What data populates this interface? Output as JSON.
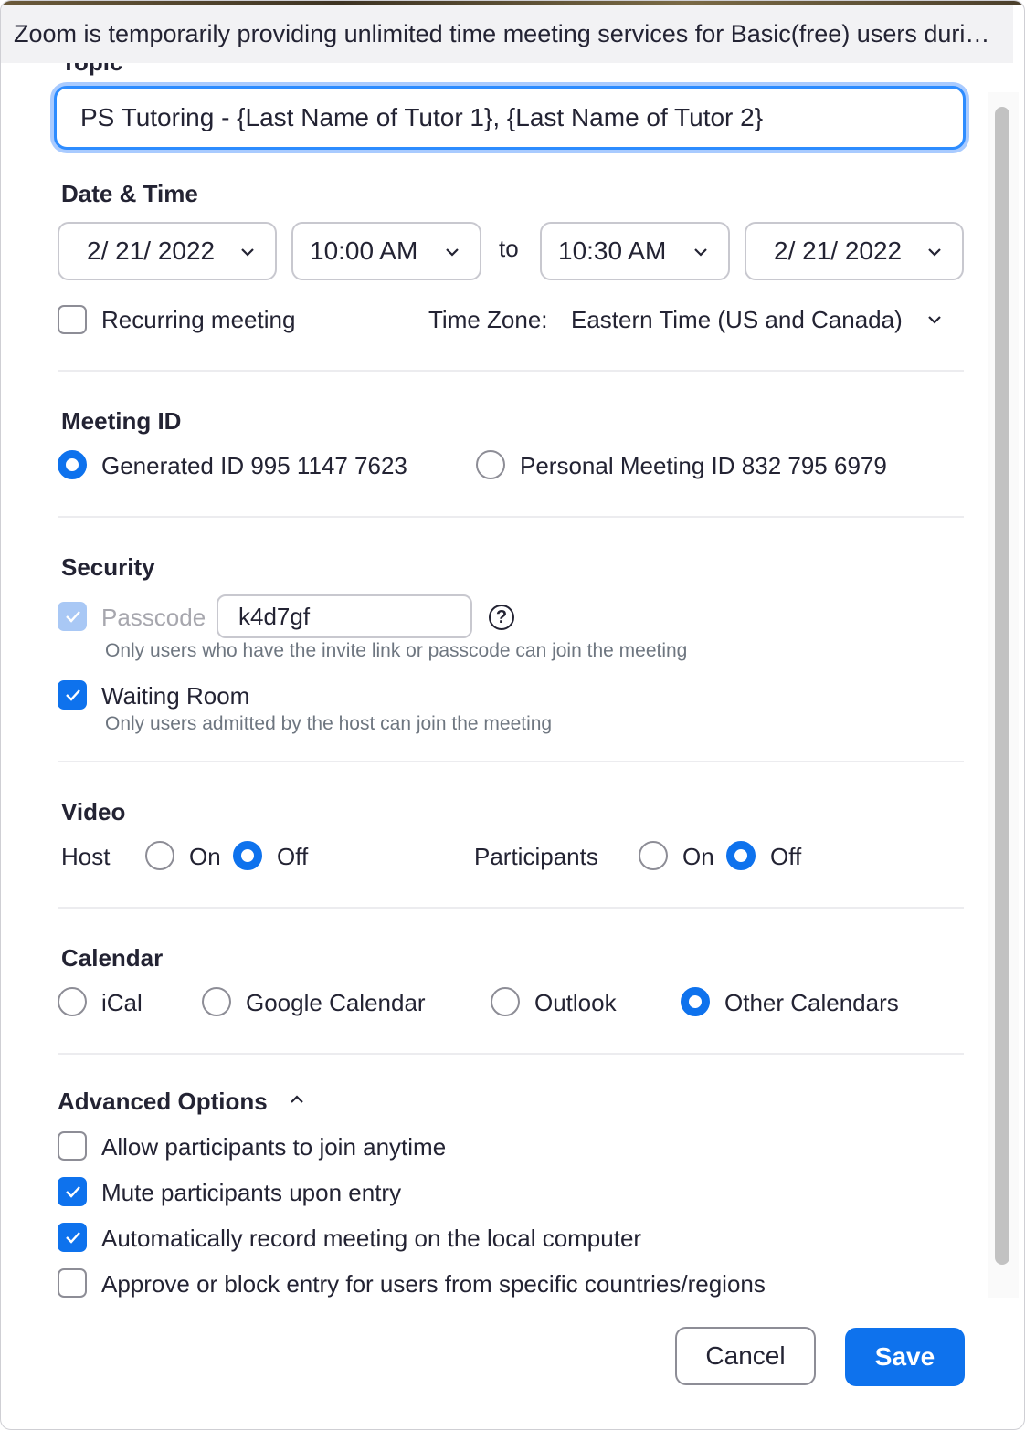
{
  "banner": {
    "text": "Zoom is temporarily providing unlimited time meeting services for Basic(free) users duri…"
  },
  "topic": {
    "label": "Topic",
    "value": "PS Tutoring - {Last Name of Tutor 1}, {Last Name of Tutor 2}"
  },
  "date_time": {
    "title": "Date & Time",
    "start_date": "2/ 21/ 2022",
    "start_time": "10:00 AM",
    "to_label": "to",
    "end_time": "10:30 AM",
    "end_date": "2/ 21/ 2022",
    "recurring_label": "Recurring meeting",
    "recurring_checked": false,
    "timezone_label": "Time Zone:",
    "timezone_value": "Eastern Time (US and Canada)"
  },
  "meeting_id": {
    "title": "Meeting ID",
    "generated_label": "Generated ID 995 1147 7623",
    "personal_label": "Personal Meeting ID 832 795 6979",
    "selected": "generated"
  },
  "security": {
    "title": "Security",
    "passcode_label": "Passcode",
    "passcode_value": "k4d7gf",
    "passcode_help": "Only users who have the invite link or passcode can join the meeting",
    "help_glyph": "?",
    "waiting_room_label": "Waiting Room",
    "waiting_room_help": "Only users admitted by the host can join the meeting"
  },
  "video": {
    "title": "Video",
    "host_label": "Host",
    "participants_label": "Participants",
    "on_label": "On",
    "off_label": "Off",
    "host_selected": "Off",
    "participants_selected": "Off"
  },
  "calendar": {
    "title": "Calendar",
    "options": [
      "iCal",
      "Google Calendar",
      "Outlook",
      "Other Calendars"
    ],
    "selected": "Other Calendars"
  },
  "advanced": {
    "title": "Advanced Options",
    "options": [
      {
        "label": "Allow participants to join anytime",
        "checked": false
      },
      {
        "label": "Mute participants upon entry",
        "checked": true
      },
      {
        "label": "Automatically record meeting on the local computer",
        "checked": true
      },
      {
        "label": "Approve or block entry for users from specific countries/regions",
        "checked": false
      }
    ]
  },
  "buttons": {
    "cancel": "Cancel",
    "save": "Save"
  },
  "colors": {
    "accent": "#0e72ed",
    "focus_ring": "#2d8cff"
  }
}
